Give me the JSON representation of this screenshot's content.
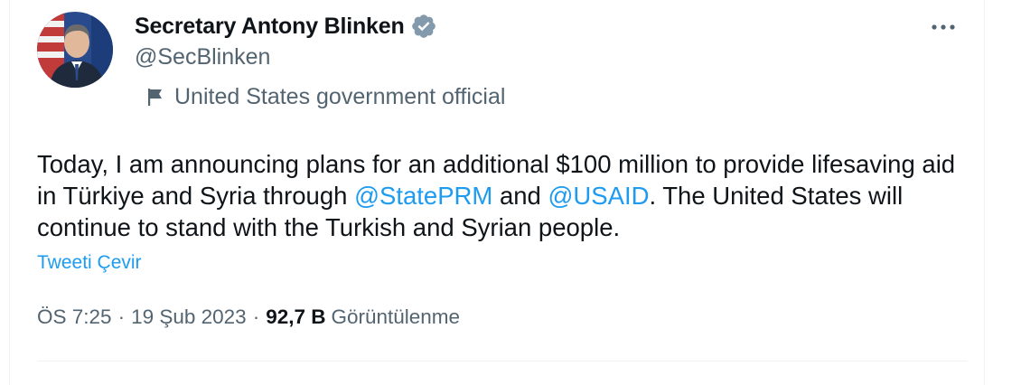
{
  "author": {
    "display_name": "Secretary Antony Blinken",
    "handle": "@SecBlinken",
    "affiliation": "United States government official",
    "verified_color": "#829aab"
  },
  "tweet": {
    "part1": "Today, I am announcing plans for an additional $100 million to provide lifesaving aid in Türkiye and Syria through ",
    "mention1": "@StatePRM",
    "part2": " and ",
    "mention2": "@USAID",
    "part3": ". The United States will continue to stand with the Turkish and Syrian people."
  },
  "translate_label": "Tweeti Çevir",
  "meta": {
    "time": "ÖS 7:25",
    "separator": "·",
    "date": "19 Şub 2023",
    "views_count": "92,7 B",
    "views_label": "Görüntülenme"
  },
  "icons": {
    "verified": "verified-badge-icon",
    "affiliation": "flag-icon",
    "more": "more-options-icon"
  },
  "colors": {
    "link": "#1d9bf0",
    "secondary_text": "#536471",
    "primary_text": "#0f1419"
  }
}
